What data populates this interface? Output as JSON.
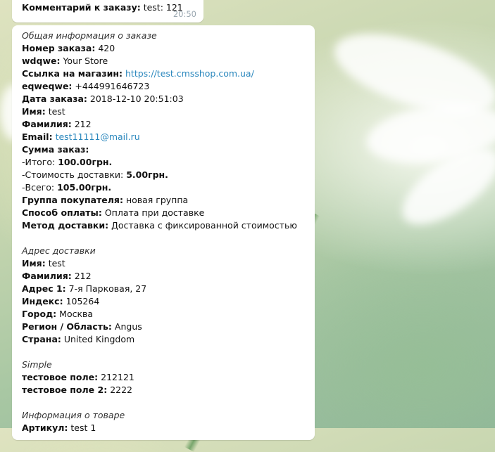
{
  "prev_message": {
    "label": "Комментарий к заказу:",
    "value": "test: 121",
    "time": "20:50"
  },
  "order": {
    "sec_general": "Общая информация о заказе",
    "order_no_label": "Номер заказа:",
    "order_no": "420",
    "store_label": "wdqwe:",
    "store": "Your Store",
    "link_label": "Ссылка на магазин:",
    "link": "https://test.cmsshop.com.ua/",
    "phone_label": "eqweqwe:",
    "phone": "+444991646723",
    "date_label": "Дата заказа:",
    "date": "2018-12-10 20:51:03",
    "name_label": "Имя:",
    "name": "test",
    "surname_label": "Фамилия:",
    "surname": "212",
    "email_label": "Email:",
    "email": "test11111@mail.ru",
    "sum_label": "Сумма заказ:",
    "subtotal_label": "-Итого:",
    "subtotal": "100.00грн.",
    "shipping_label": "-Стоимость доставки:",
    "shipping": "5.00грн.",
    "total_label": "-Всего:",
    "total": "105.00грн.",
    "group_label": "Группа покупателя:",
    "group": "новая группа",
    "payment_label": "Способ оплаты:",
    "payment": "Оплата при доставке",
    "delivery_label": "Метод доставки:",
    "delivery": "Доставка с фиксированной стоимостью"
  },
  "address": {
    "sec": "Адрес доставки",
    "name_label": "Имя:",
    "name": "test",
    "surname_label": "Фамилия:",
    "surname": "212",
    "addr_label": "Адрес 1:",
    "addr": "7-я Парковая, 27",
    "index_label": "Индекс:",
    "index": "105264",
    "city_label": "Город:",
    "city": "Москва",
    "region_label": "Регион / Область:",
    "region": "Angus",
    "country_label": "Страна:",
    "country": "United Kingdom"
  },
  "simple": {
    "sec": "Simple",
    "f1_label": "тестовое поле:",
    "f1": "212121",
    "f2_label": "тестовое поле 2:",
    "f2": "2222"
  },
  "product": {
    "sec": "Информация о товаре",
    "art_label": "Артикул:",
    "art": "test 1"
  }
}
